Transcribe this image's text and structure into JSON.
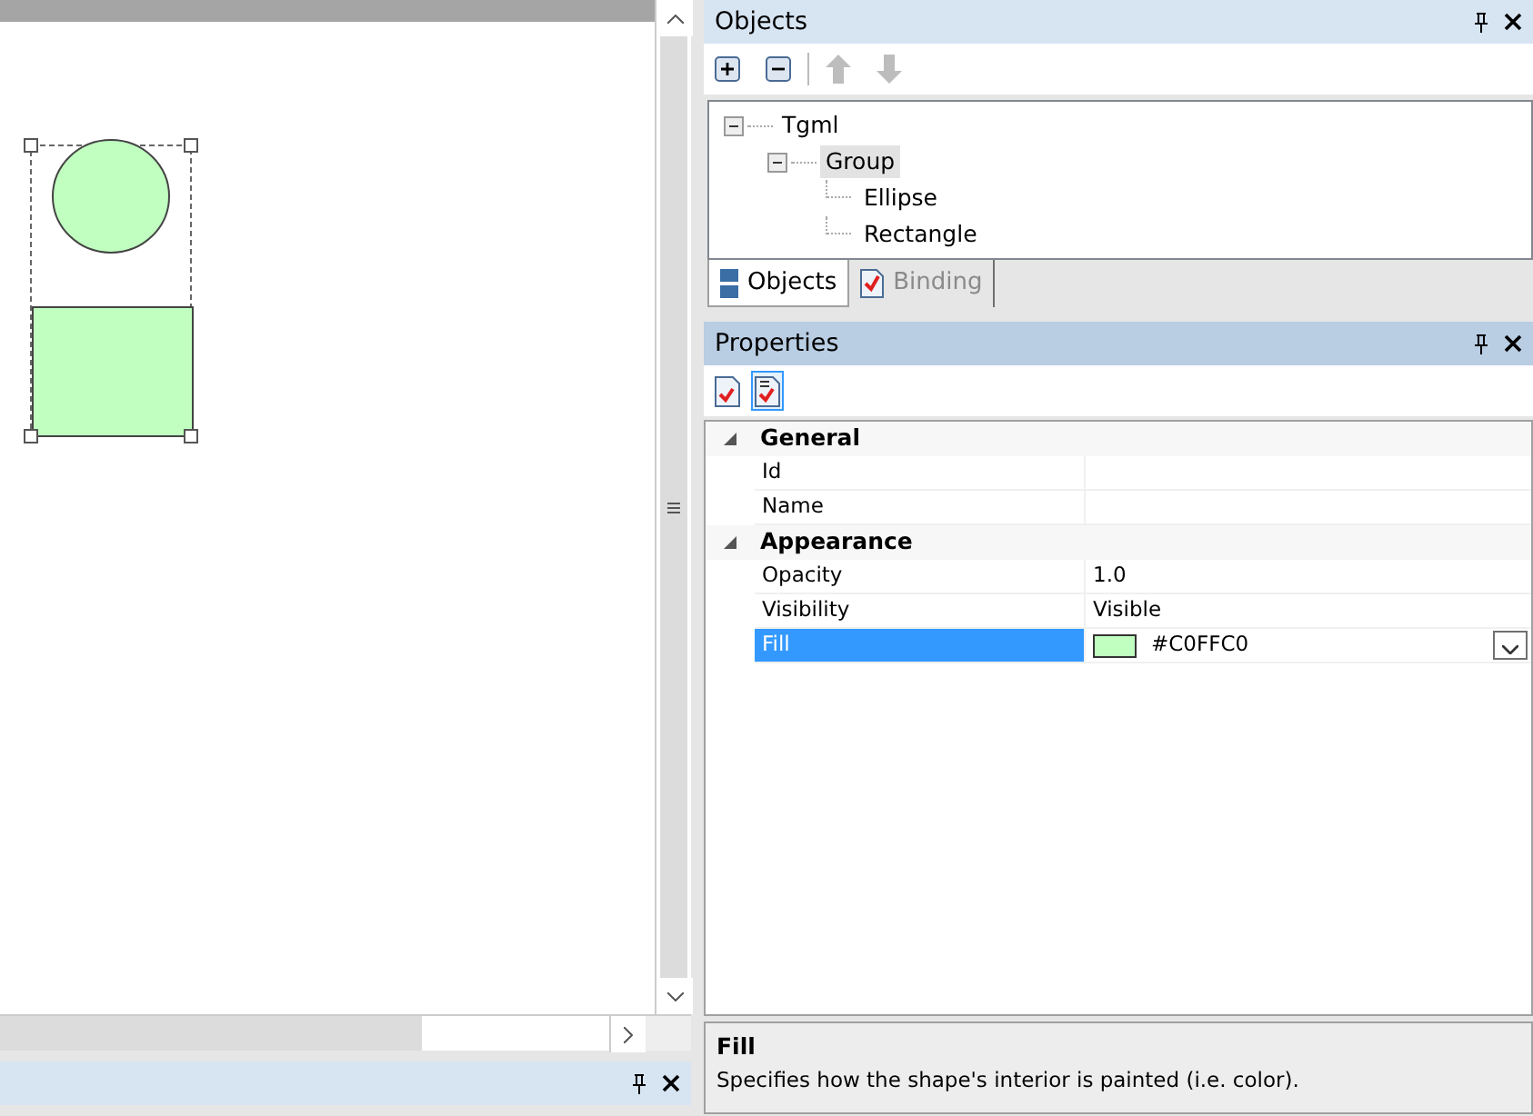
{
  "objects_panel": {
    "title": "Objects",
    "tree": [
      {
        "label": "Tgml",
        "expanded": true,
        "selected": false,
        "children": [
          {
            "label": "Group",
            "expanded": true,
            "selected": true,
            "children": [
              {
                "label": "Ellipse",
                "selected": false
              },
              {
                "label": "Rectangle",
                "selected": false
              }
            ]
          }
        ]
      }
    ],
    "tabs": [
      {
        "label": "Objects",
        "selected": true
      },
      {
        "label": "Binding",
        "selected": false
      }
    ]
  },
  "properties_panel": {
    "title": "Properties",
    "view_buttons": [
      {
        "kind": "alphabetical",
        "selected": false
      },
      {
        "kind": "categorized",
        "selected": true
      }
    ],
    "categories": [
      {
        "label": "General",
        "expanded": true,
        "properties": [
          {
            "name": "Id",
            "selected": false
          },
          {
            "name": "Name",
            "selected": false
          }
        ]
      },
      {
        "label": "Appearance",
        "expanded": true,
        "properties": [
          {
            "name": "Opacity",
            "value": "1.0",
            "selected": false
          },
          {
            "name": "Visibility",
            "value": "Visible",
            "selected": false
          },
          {
            "name": "Fill",
            "value": "#C0FFC0",
            "color": "#c0ffc0",
            "selected": true
          }
        ]
      }
    ],
    "description": {
      "title": "Fill",
      "text": "Specifies how the shape's interior is painted (i.e. color)."
    }
  }
}
